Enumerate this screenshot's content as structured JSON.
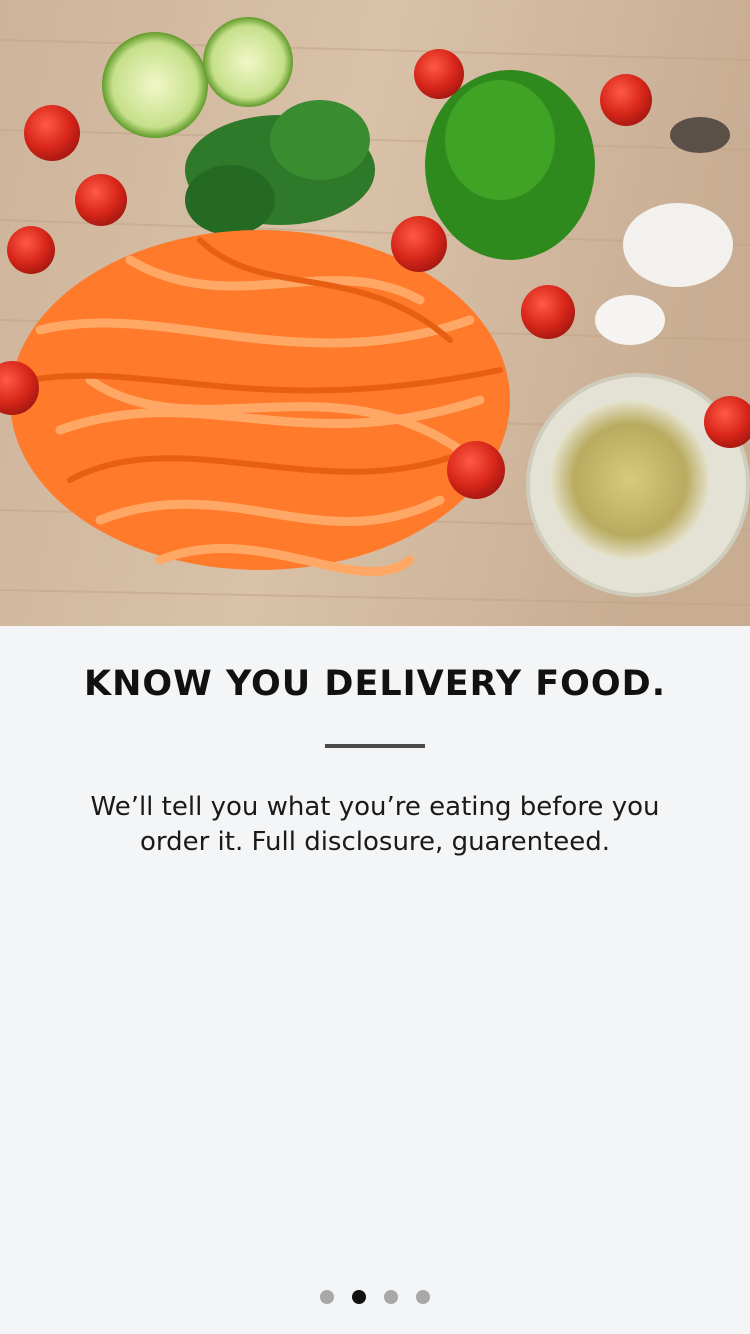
{
  "onboarding": {
    "title": "KNOW YOU DELIVERY FOOD.",
    "description": "We’ll tell you what you’re eating before you order it. Full disclosure, guarenteed.",
    "hero_image": "fresh-ingredients-on-cutting-board",
    "pager": {
      "total": 4,
      "active_index": 1
    }
  },
  "colors": {
    "background": "#f3f5f6",
    "title": "#111111",
    "divider": "#4a4a4a",
    "dot_inactive": "#a8a8a8",
    "dot_active": "#111111"
  }
}
